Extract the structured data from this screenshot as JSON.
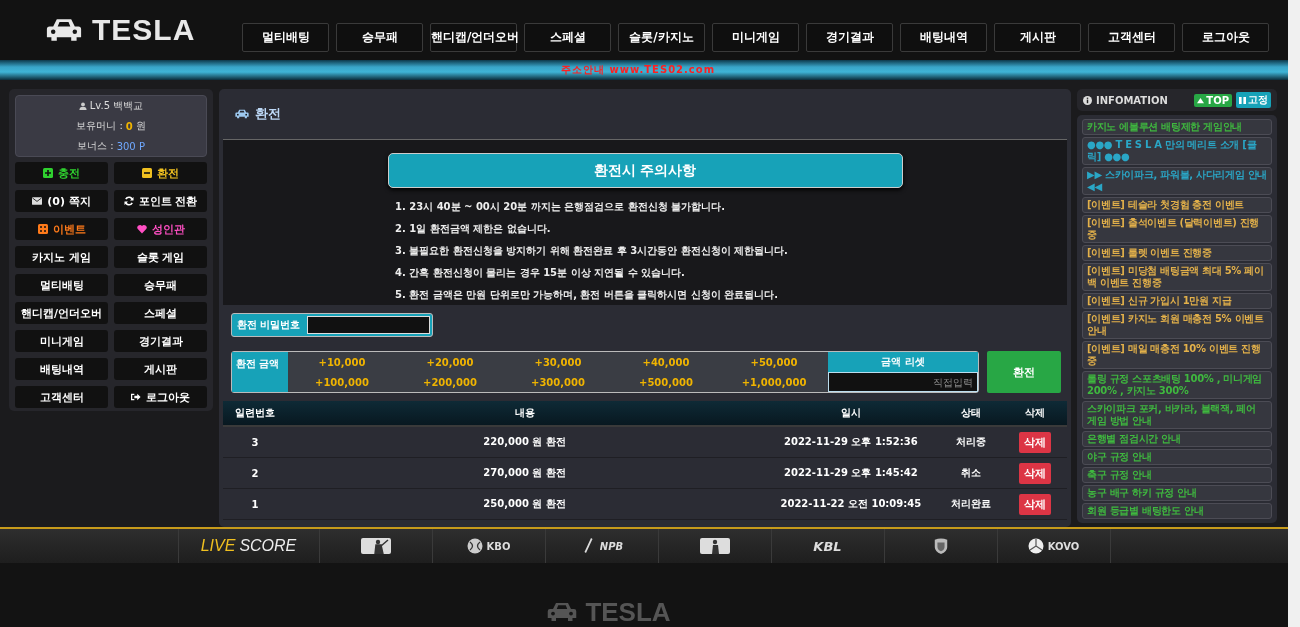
{
  "header": {
    "logo": "TESLA",
    "nav": [
      "멀티배팅",
      "승무패",
      "핸디캡/언더오버",
      "스페셜",
      "슬롯/카지노",
      "미니게임",
      "경기결과",
      "배팅내역",
      "게시판",
      "고객센터",
      "로그아웃"
    ]
  },
  "notice_bar": {
    "text": "주소안내 www.TES02.com"
  },
  "user_panel": {
    "level": "Lv.5 백백교",
    "balance_label": "보유머니 :",
    "balance": "0",
    "balance_unit": "원",
    "bonus_label": "보너스 :",
    "bonus": "300 P"
  },
  "side_menu": [
    {
      "label": "충전",
      "kind": "charge"
    },
    {
      "label": "환전",
      "kind": "exchange"
    },
    {
      "label": "(0) 쪽지",
      "kind": "message"
    },
    {
      "label": "포인트 전환",
      "kind": "points"
    },
    {
      "label": "이벤트",
      "kind": "event"
    },
    {
      "label": "성인관",
      "kind": "adult"
    },
    {
      "label": "카지노 게임",
      "kind": "plain"
    },
    {
      "label": "슬롯 게임",
      "kind": "plain"
    },
    {
      "label": "멀티배팅",
      "kind": "plain"
    },
    {
      "label": "승무패",
      "kind": "plain"
    },
    {
      "label": "핸디캡/언더오버",
      "kind": "plain"
    },
    {
      "label": "스페셜",
      "kind": "plain"
    },
    {
      "label": "미니게임",
      "kind": "plain"
    },
    {
      "label": "경기결과",
      "kind": "plain"
    },
    {
      "label": "배팅내역",
      "kind": "plain"
    },
    {
      "label": "게시판",
      "kind": "plain"
    },
    {
      "label": "고객센터",
      "kind": "plain"
    },
    {
      "label": "로그아웃",
      "kind": "logout"
    }
  ],
  "page": {
    "title": "환전",
    "notice_title": "환전시 주의사항",
    "notices": [
      "1. 23시 40분 ~ 00시 20분 까지는 은행점검으로 환전신청 불가합니다.",
      "2. 1일 환전금액 제한은 없습니다.",
      "3. 불필요한 환전신청을 방지하기 위해 환전완료 후 3시간동안 환전신청이 제한됩니다.",
      "4. 간혹 환전신청이 몰리는 경우 15분 이상 지연될 수 있습니다.",
      "5. 환전 금액은 만원 단위로만 가능하며, 환전 버튼을 클릭하시면 신청이 완료됩니다."
    ],
    "password_label": "환전 비밀번호",
    "amount_label": "환전 금액",
    "amounts": [
      "+10,000",
      "+20,000",
      "+30,000",
      "+40,000",
      "+50,000",
      "+100,000",
      "+200,000",
      "+300,000",
      "+500,000",
      "+1,000,000"
    ],
    "reset_button": "금액 리셋",
    "custom_amount": {
      "placeholder": "직접입력"
    },
    "submit_button": "환전"
  },
  "table": {
    "columns": [
      "일련번호",
      "내용",
      "일시",
      "상태",
      "삭제"
    ],
    "rows": [
      {
        "no": "3",
        "content": "220,000 원 환전",
        "date": "2022-11-29 오후 1:52:36",
        "status": "처리중",
        "action": "삭제"
      },
      {
        "no": "2",
        "content": "270,000 원 환전",
        "date": "2022-11-29 오후 1:45:42",
        "status": "취소",
        "action": "삭제"
      },
      {
        "no": "1",
        "content": "250,000 원 환전",
        "date": "2022-11-22 오전 10:09:45",
        "status": "처리완료",
        "action": "삭제"
      }
    ]
  },
  "info": {
    "title": "INFOMATION",
    "top_button": "TOP",
    "pin_button": "고정",
    "items": [
      {
        "text": "카지노 에볼루션 배팅제한 게임안내",
        "color": "#3fb83f"
      },
      {
        "text": "●●● T E S L A 만의 메리트 소개 [클릭] ●●●",
        "color": "#2aa6c6"
      },
      {
        "text": "▶▶ 스카이파크, 파워볼, 사다리게임 안내 ◀◀",
        "color": "#2aa6c6"
      },
      {
        "text": "[이벤트] 테슬라 첫경험 충전 이벤트",
        "color": "#e2b04a"
      },
      {
        "text": "[이벤트] 출석이벤트 (달력이벤트) 진행중",
        "color": "#e2b04a"
      },
      {
        "text": "[이벤트] 룰렛 이벤트 진행중",
        "color": "#e2b04a"
      },
      {
        "text": "[이벤트] 미당첨 배팅금액 최대 5% 페이백 이벤트 진행중",
        "color": "#e2b04a"
      },
      {
        "text": "[이벤트] 신규 가입시 1만원 지급",
        "color": "#e2b04a"
      },
      {
        "text": "[이벤트] 카지노 회원 매충전 5% 이벤트 안내",
        "color": "#e2b04a"
      },
      {
        "text": "[이벤트] 매일 매충전 10% 이벤트 진행중",
        "color": "#e2b04a"
      },
      {
        "text": "롤링 규정 스포츠배팅 100% , 미니게임 200% , 카지노 300%",
        "color": "#3fb83f"
      },
      {
        "text": "스카이파크 포커, 바카라, 블랙잭, 페어 게임 방법 안내",
        "color": "#3fb83f"
      },
      {
        "text": "은행별 점검시간 안내",
        "color": "#3fb83f"
      },
      {
        "text": "야구 규정 안내",
        "color": "#3fb83f"
      },
      {
        "text": "축구 규정 안내",
        "color": "#3fb83f"
      },
      {
        "text": "농구 배구 하키 규정 안내",
        "color": "#3fb83f"
      },
      {
        "text": "회원 등급별 배팅한도 안내",
        "color": "#3fb83f"
      }
    ]
  },
  "livescore": {
    "logo": [
      "LIVE",
      "SCORE"
    ],
    "leagues": [
      {
        "kind": "baseball-batter"
      },
      {
        "kind": "kbo",
        "label": "KBO"
      },
      {
        "kind": "npb",
        "label": "NPB"
      },
      {
        "kind": "basketball-player"
      },
      {
        "kind": "kbl",
        "label": "KBL"
      },
      {
        "kind": "shield"
      },
      {
        "kind": "kovo",
        "label": "KOVO"
      }
    ]
  },
  "footer": {
    "logo": "TESLA"
  }
}
